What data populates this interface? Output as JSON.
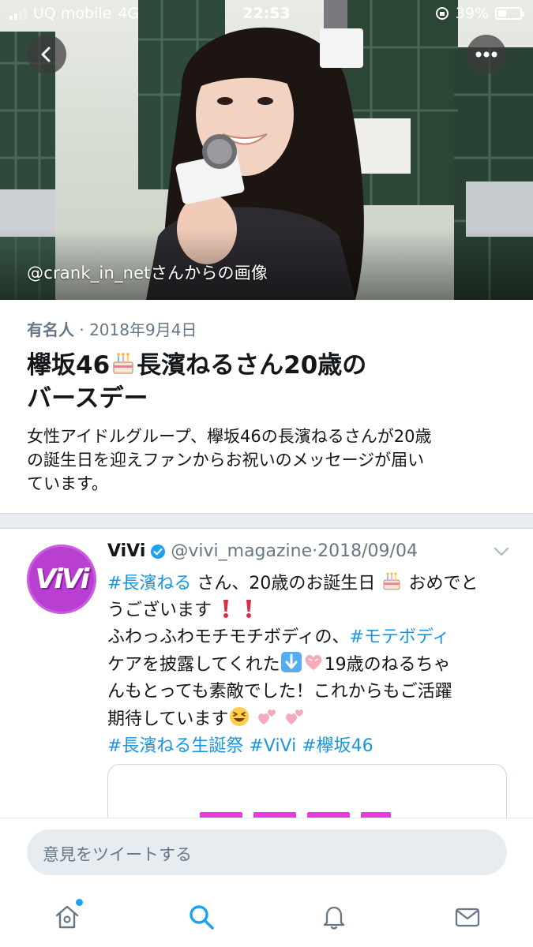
{
  "status_bar": {
    "carrier": "UQ mobile",
    "network": "4G",
    "time": "22:53",
    "battery_percent": "39%",
    "battery_level": 0.39
  },
  "hero": {
    "credit": "@crank_in_netさんからの画像"
  },
  "moment": {
    "category": "有名人",
    "separator": " · ",
    "date": "2018年9月4日",
    "title_line1_a": "欅坂46",
    "title_line1_b": "長濱ねるさん20歳の",
    "title_line2": "バースデー",
    "description_line1": "女性アイドルグループ、欅坂46の長濱ねるさんが20歳",
    "description_line2": "の誕生日を迎えファンからお祝いのメッセージが届い",
    "description_line3": "ています。"
  },
  "tweet": {
    "avatar_text": "ViVi",
    "name": "ViVi",
    "handle": "@vivi_magazine",
    "separator": "·",
    "date": "2018/09/04",
    "l1_tag": "#長濱ねる",
    "l1_text": " さん、20歳のお誕生日",
    "l1_text2": "おめでと",
    "l2_text": "うございます",
    "l3_text": "ふわっふわモチモチボディの、",
    "l3_tag": "#モテボディ",
    "l4_text": "ケアを披露してくれた",
    "l4_text2": "19歳のねるちゃ",
    "l5_text": "んもとっても素敵でした！これからもご活躍",
    "l6_text": "期待しています",
    "l7_tag1": "#長濱ねる生誕祭",
    "l7_tag2": "#ViVi",
    "l7_tag3": "#欅坂46"
  },
  "composer": {
    "placeholder": "意見をツイートする"
  },
  "icons": [
    "back-arrow-icon",
    "more-dots-icon",
    "verified-badge-icon",
    "chevron-down-icon",
    "home-icon",
    "search-icon",
    "notifications-bell-icon",
    "messages-envelope-icon",
    "cake-emoji-icon",
    "exclamation-emoji-icon",
    "down-arrow-emoji-icon",
    "pink-heart-emoji-icon",
    "laughing-emoji-icon",
    "two-hearts-emoji-icon"
  ],
  "colors": {
    "link": "#1b95e0",
    "accent": "#1da1f2",
    "secondary_text": "#657786",
    "avatar_bg": "#b83fcf"
  }
}
